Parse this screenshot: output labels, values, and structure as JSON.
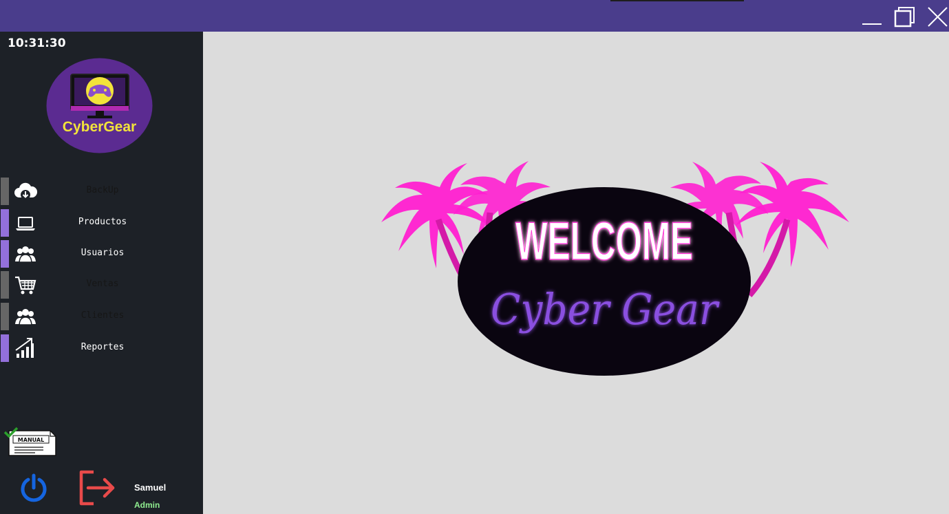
{
  "window": {
    "minimize_icon": "minimize-icon",
    "maximize_icon": "maximize-icon",
    "close_icon": "close-icon",
    "titlebar_color": "#4a3d8c"
  },
  "sidebar": {
    "clock": "10:31:30",
    "logo_text": "CyberGear",
    "items": [
      {
        "label": "BackUp",
        "icon": "cloud-download-icon",
        "active": false
      },
      {
        "label": "Productos",
        "icon": "laptop-icon",
        "active": true
      },
      {
        "label": "Usuarios",
        "icon": "users-icon",
        "active": true
      },
      {
        "label": "Ventas",
        "icon": "shopping-cart-icon",
        "active": false
      },
      {
        "label": "Clientes",
        "icon": "clients-icon",
        "active": false
      },
      {
        "label": "Reportes",
        "icon": "bar-chart-icon",
        "active": true
      }
    ],
    "manual_label": "MANUAL",
    "user": {
      "name": "Samuel",
      "role": "Admin"
    }
  },
  "main": {
    "welcome_title": "WELCOME",
    "welcome_subtitle": "Cyber Gear"
  },
  "colors": {
    "accent": "#9370db",
    "inactive_bar": "#666666",
    "neon_pink": "#ff1fd0",
    "neon_purple": "#8a4fe0",
    "role_green": "#90ee90"
  }
}
